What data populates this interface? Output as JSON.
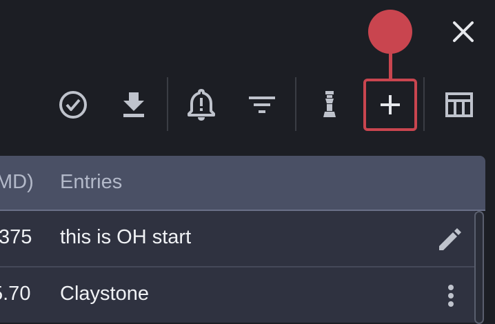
{
  "close": {
    "icon": "close-icon"
  },
  "annotation": {
    "color": "#c9454f",
    "target": "add-button"
  },
  "toolbar": {
    "items": [
      {
        "name": "check-circle-button",
        "icon": "check-circle-icon"
      },
      {
        "name": "download-button",
        "icon": "download-icon"
      },
      {
        "name": "alert-bell-button",
        "icon": "bell-alert-icon"
      },
      {
        "name": "filter-button",
        "icon": "filter-icon"
      },
      {
        "name": "chess-piece-button",
        "icon": "chess-piece-icon"
      },
      {
        "name": "add-button",
        "icon": "plus-icon"
      },
      {
        "name": "table-layout-button",
        "icon": "table-layout-icon"
      }
    ]
  },
  "table": {
    "columns": [
      "MD)",
      "Entries"
    ],
    "rows": [
      {
        "value": "375",
        "entry": "this is OH start",
        "action_icon": "pencil-icon"
      },
      {
        "value": "5.70",
        "entry": "Claystone",
        "action_icon": "more-vertical-icon"
      }
    ]
  },
  "colors": {
    "background": "#1c1e24",
    "header": "#4a5065",
    "row": "#2f3240",
    "accent": "#c9454f",
    "icon": "#bfc3cc"
  }
}
